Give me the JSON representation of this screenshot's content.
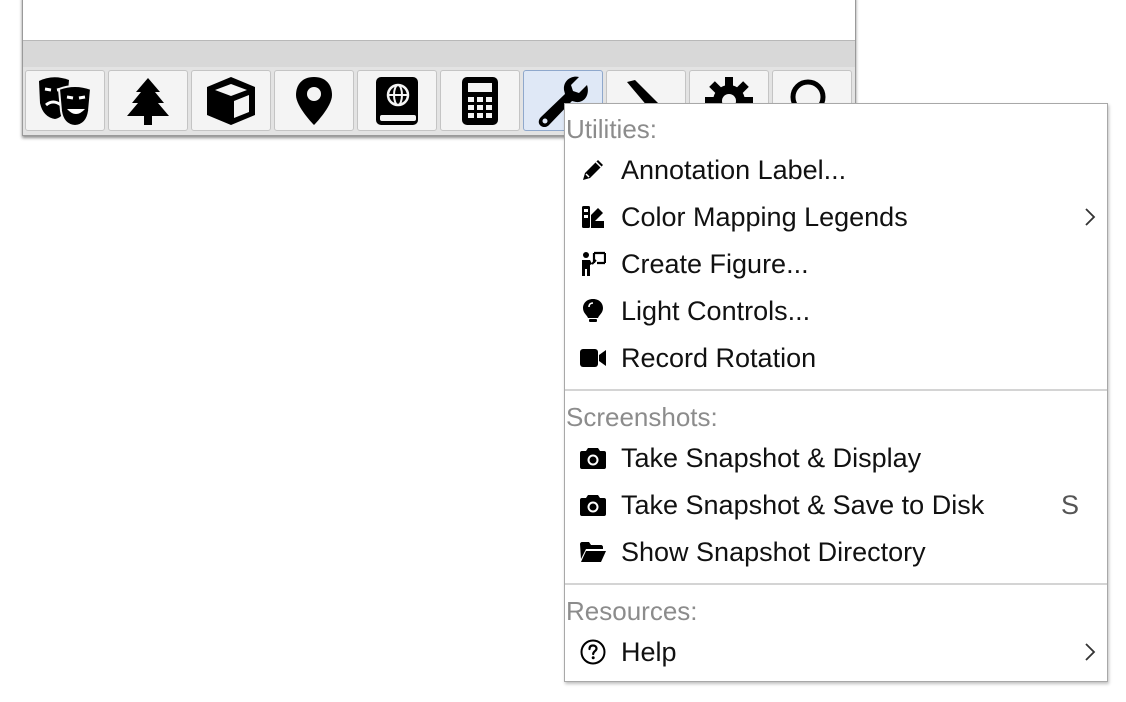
{
  "toolbar": {
    "buttons": [
      {
        "icon": "theater-masks-icon"
      },
      {
        "icon": "tree-icon"
      },
      {
        "icon": "cube-icon"
      },
      {
        "icon": "map-pin-icon"
      },
      {
        "icon": "atlas-book-icon"
      },
      {
        "icon": "calculator-icon"
      },
      {
        "icon": "wrench-icon",
        "active": true
      },
      {
        "icon": "pencil-icon"
      },
      {
        "icon": "gear-icon"
      },
      {
        "icon": "search-icon"
      }
    ]
  },
  "menu": {
    "sections": [
      {
        "header": "Utilities:",
        "items": [
          {
            "label": "Annotation Label...",
            "icon": "pencil-icon"
          },
          {
            "label": "Color Mapping Legends",
            "icon": "swatchbook-icon",
            "submenu": true
          },
          {
            "label": "Create Figure...",
            "icon": "presenter-icon"
          },
          {
            "label": "Light Controls...",
            "icon": "lightbulb-icon"
          },
          {
            "label": "Record Rotation",
            "icon": "video-camera-icon"
          }
        ]
      },
      {
        "header": "Screenshots:",
        "items": [
          {
            "label": "Take Snapshot & Display",
            "icon": "camera-icon"
          },
          {
            "label": "Take Snapshot & Save to Disk",
            "icon": "camera-icon",
            "shortcut": "S"
          },
          {
            "label": "Show Snapshot Directory",
            "icon": "folder-open-icon"
          }
        ]
      },
      {
        "header": "Resources:",
        "items": [
          {
            "label": "Help",
            "icon": "question-circle-icon",
            "submenu": true
          }
        ]
      }
    ]
  }
}
